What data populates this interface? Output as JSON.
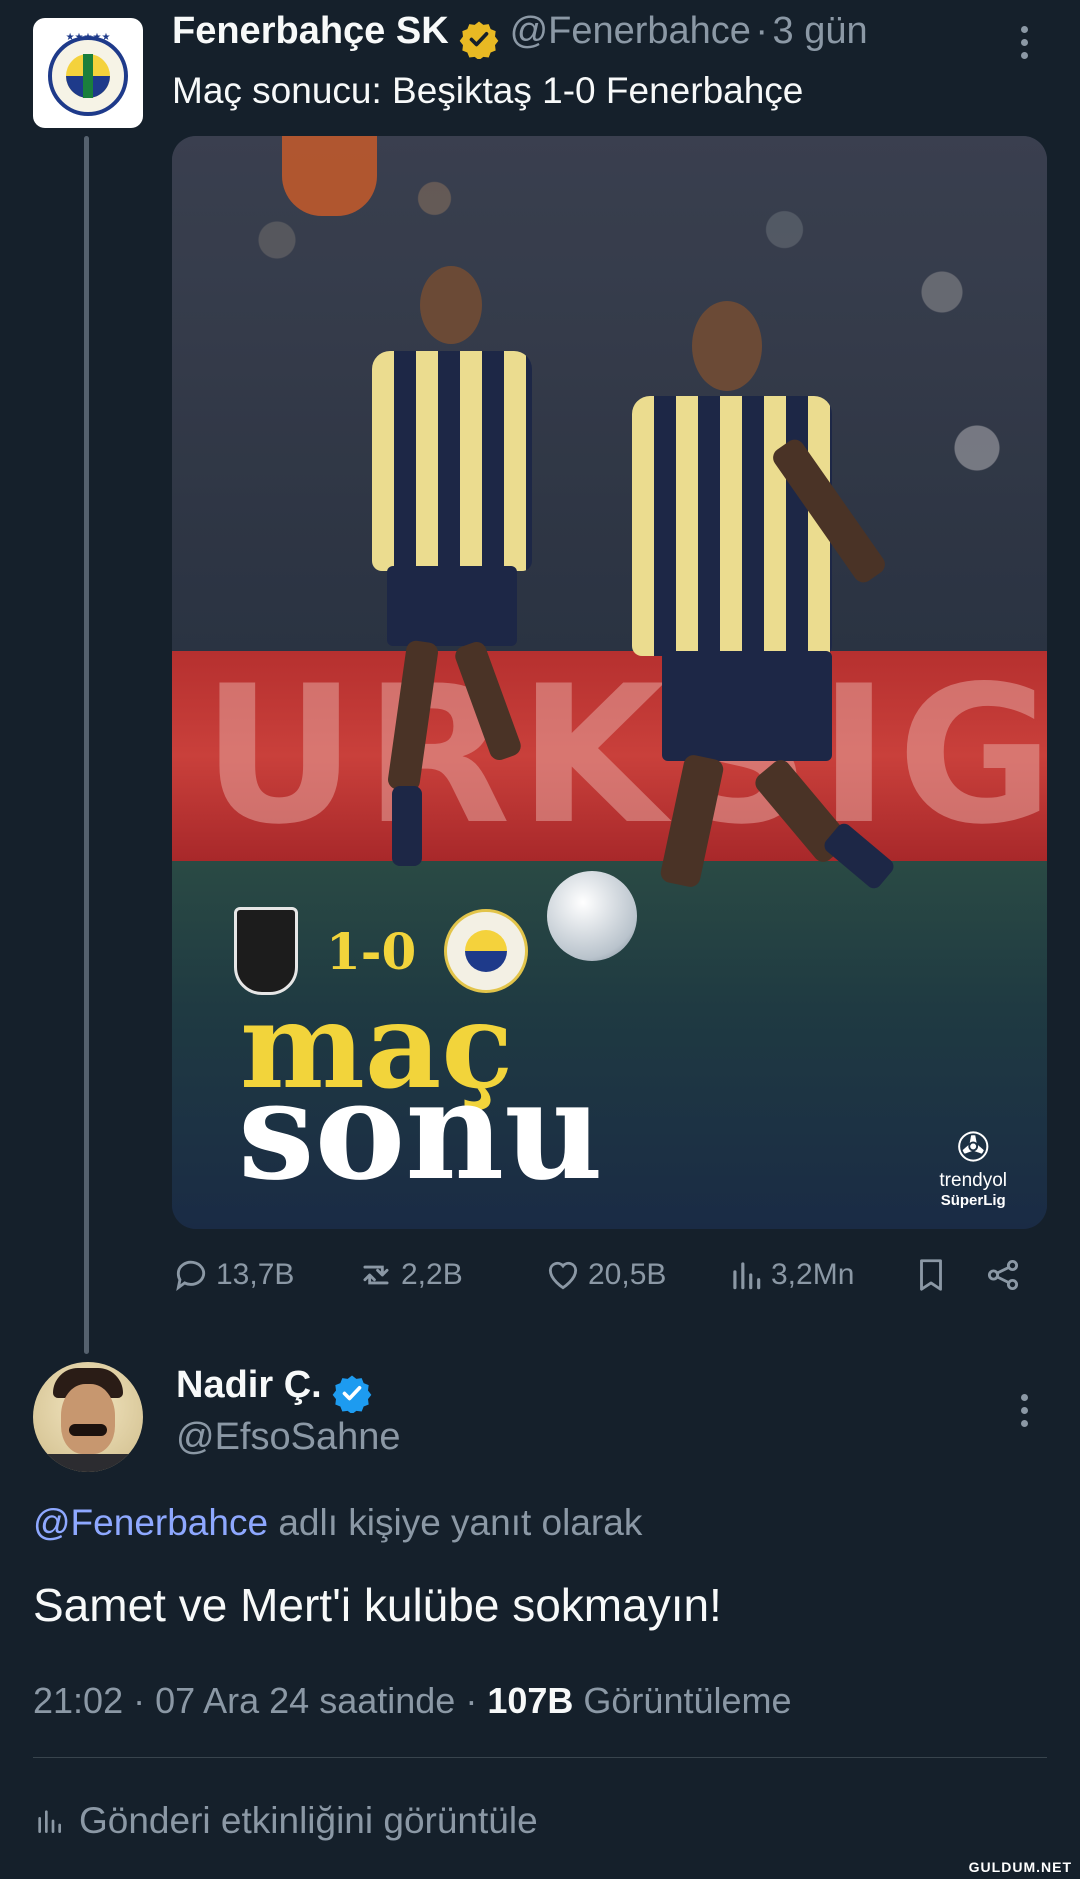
{
  "original_tweet": {
    "author_name": "Fenerbahçe SK",
    "handle": "@Fenerbahce",
    "time_sep": "·",
    "time": "3 gün",
    "text": "Maç sonucu: Beşiktaş 1-0 Fenerbahçe",
    "media": {
      "score": "1-0",
      "headline_top": "maç",
      "headline_bottom": "sonu",
      "league_line1": "trendyol",
      "league_line2": "SüperLig",
      "board_text": "URKSIG"
    },
    "actions": {
      "replies": "13,7B",
      "retweets": "2,2B",
      "likes": "20,5B",
      "views": "3,2Mn"
    }
  },
  "reply_tweet": {
    "author_name": "Nadir Ç.",
    "handle": "@EfsoSahne",
    "reply_mention": "@Fenerbahce",
    "reply_suffix": "adlı kişiye yanıt olarak",
    "text": "Samet ve Mert'i kulübe sokmayın!",
    "timestamp": "21:02 · 07 Ara 24 saatinde ·",
    "views_count": "107B",
    "views_label": "Görüntüleme",
    "activity_link": "Gönderi etkinliğini görüntüle"
  },
  "watermark": "GULDUM.NET",
  "colors": {
    "background": "#15202b",
    "muted": "#8b98a5",
    "gold_check": "#e8b923",
    "blue_check": "#1d9bf0",
    "mention": "#8ea8ff",
    "score_yellow": "#f2d43b"
  }
}
